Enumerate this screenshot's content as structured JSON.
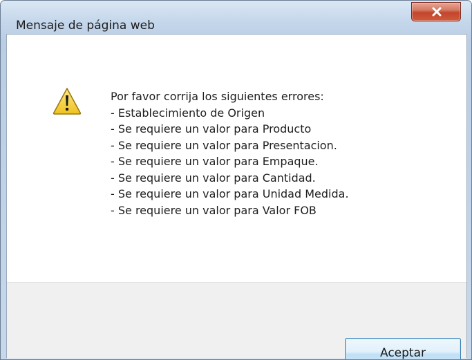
{
  "dialog": {
    "title": "Mensaje de página web",
    "close_icon": "close-x-icon",
    "message_icon": "warning-icon",
    "message_lines": [
      "Por favor corrija los siguientes errores:",
      "- Establecimiento de Origen",
      "- Se requiere un valor para Producto",
      "- Se requiere un valor para Presentacion.",
      "- Se requiere un valor para Empaque.",
      "- Se requiere un valor para Cantidad.",
      "- Se requiere un valor para Unidad Medida.",
      "- Se requiere un valor para Valor FOB"
    ],
    "ok_label": "Aceptar"
  },
  "colors": {
    "close_button": "#c4452c",
    "warning_fill": "#f6d33a",
    "ok_button_border": "#3c7fb1"
  }
}
